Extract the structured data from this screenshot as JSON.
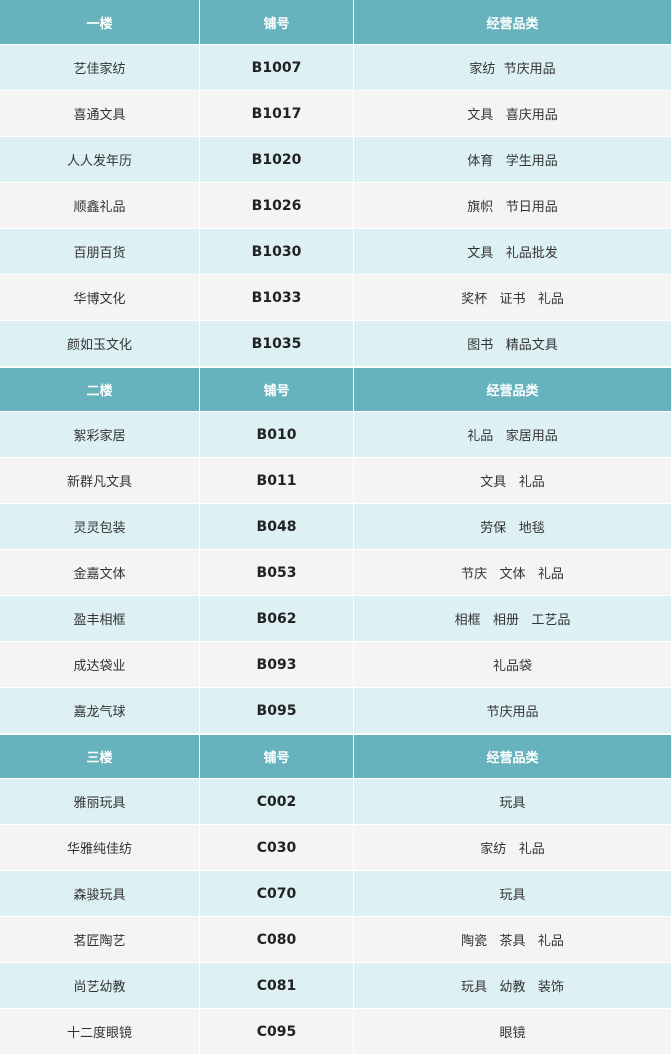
{
  "sections": [
    {
      "floor": "一楼",
      "code_header": "铺号",
      "category_header": "经营品类",
      "rows": [
        {
          "name": "艺佳家纺",
          "code": "B1007",
          "category": "家纺  节庆用品"
        },
        {
          "name": "喜通文具",
          "code": "B1017",
          "category": "文具   喜庆用品"
        },
        {
          "name": "人人发年历",
          "code": "B1020",
          "category": "体育   学生用品"
        },
        {
          "name": "顺鑫礼品",
          "code": "B1026",
          "category": "旗帜   节日用品"
        },
        {
          "name": "百朋百货",
          "code": "B1030",
          "category": "文具   礼品批发"
        },
        {
          "name": "华博文化",
          "code": "B1033",
          "category": "奖杯   证书   礼品"
        },
        {
          "name": "颜如玉文化",
          "code": "B1035",
          "category": "图书   精品文具"
        }
      ]
    },
    {
      "floor": "二楼",
      "code_header": "铺号",
      "category_header": "经营品类",
      "rows": [
        {
          "name": "絮彩家居",
          "code": "B010",
          "category": "礼品   家居用品"
        },
        {
          "name": "新群凡文具",
          "code": "B011",
          "category": "文具   礼品"
        },
        {
          "name": "灵灵包装",
          "code": "B048",
          "category": "劳保   地毯"
        },
        {
          "name": "金嘉文体",
          "code": "B053",
          "category": "节庆   文体   礼品"
        },
        {
          "name": "盈丰相框",
          "code": "B062",
          "category": "相框   相册   工艺品"
        },
        {
          "name": "成达袋业",
          "code": "B093",
          "category": "礼品袋"
        },
        {
          "name": "嘉龙气球",
          "code": "B095",
          "category": "节庆用品"
        }
      ]
    },
    {
      "floor": "三楼",
      "code_header": "铺号",
      "category_header": "经营品类",
      "rows": [
        {
          "name": "雅丽玩具",
          "code": "C002",
          "category": "玩具"
        },
        {
          "name": "华雅纯佳纺",
          "code": "C030",
          "category": "家纺   礼品"
        },
        {
          "name": "森骏玩具",
          "code": "C070",
          "category": "玩具"
        },
        {
          "name": "茗匠陶艺",
          "code": "C080",
          "category": "陶瓷   茶具   礼品"
        },
        {
          "name": "尚艺幼教",
          "code": "C081",
          "category": "玩具   幼教   装饰"
        },
        {
          "name": "十二度眼镜",
          "code": "C095",
          "category": "眼镜"
        }
      ]
    }
  ]
}
